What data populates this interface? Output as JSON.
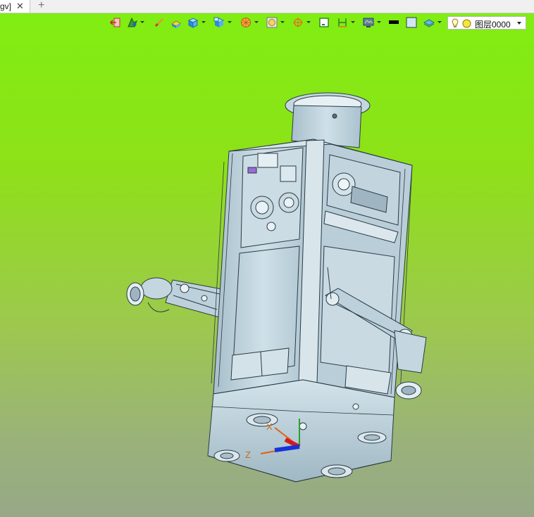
{
  "tab": {
    "label": "gv]",
    "close": "✕",
    "add": "+"
  },
  "toolbar": {
    "icons": [
      "exit-view-icon",
      "render-mode-icon",
      "measure-icon",
      "section-icon",
      "view-cube-icon",
      "view-orient-icon",
      "sphere-rotate-icon",
      "zoom-fit-icon",
      "center-pick-icon",
      "frame-icon",
      "dimension-icon",
      "display-settings-icon",
      "color-black-icon",
      "color-light-icon",
      "layer-tools-icon"
    ],
    "layer": {
      "name": "图层0000"
    }
  },
  "axes": {
    "x": "X",
    "z": "Z"
  },
  "colors": {
    "model_fill": "#c5d8e2",
    "model_dark": "#8aa3b0",
    "edge": "#2b3a44",
    "background_top": "#80ee12",
    "background_bottom": "#97a887"
  }
}
